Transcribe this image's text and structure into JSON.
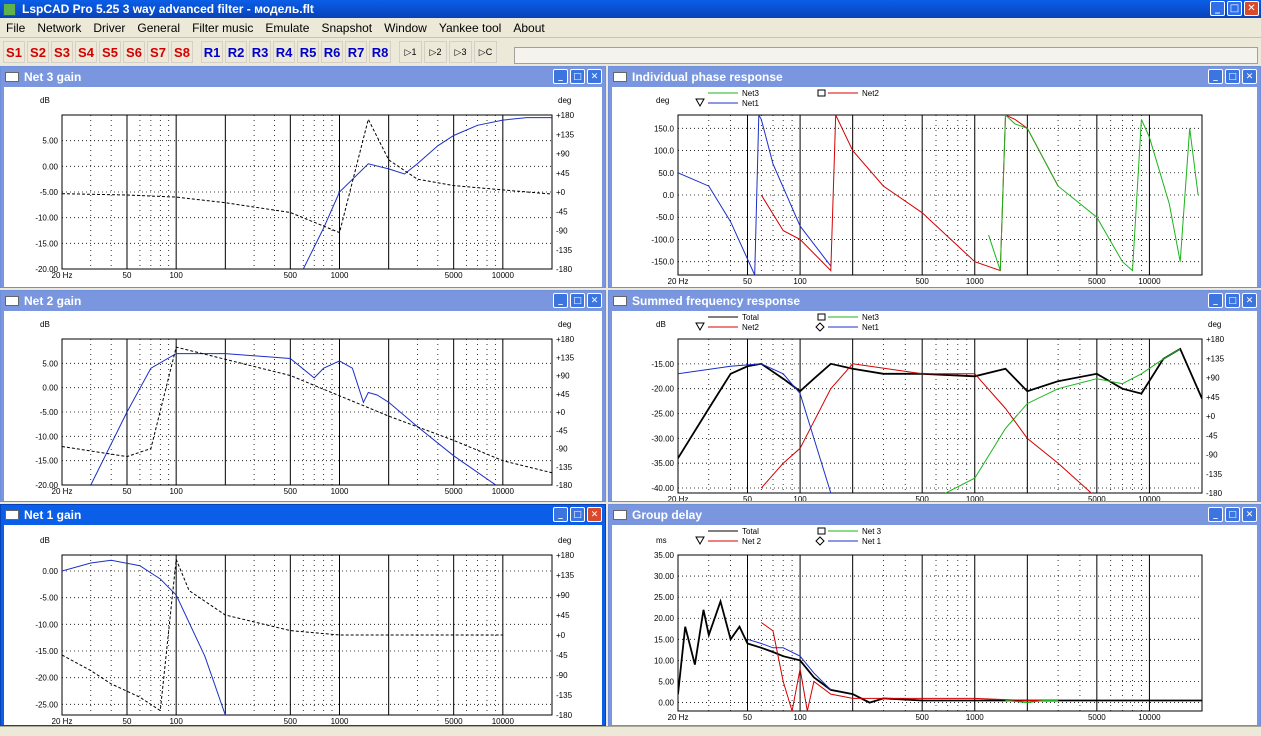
{
  "app": {
    "title": "LspCAD Pro 5.25 3 way advanced filter - модель.flt"
  },
  "menu": [
    "File",
    "Network",
    "Driver",
    "General",
    "Filter music",
    "Emulate",
    "Snapshot",
    "Window",
    "Yankee tool",
    "About"
  ],
  "toolbar": {
    "s_buttons": [
      "S1",
      "S2",
      "S3",
      "S4",
      "S5",
      "S6",
      "S7",
      "S8"
    ],
    "r_buttons": [
      "R1",
      "R2",
      "R3",
      "R4",
      "R5",
      "R6",
      "R7",
      "R8"
    ],
    "extra_buttons": [
      "▷1",
      "▷2",
      "▷3",
      "▷C"
    ]
  },
  "colors": {
    "total": "#000000",
    "net1": "#1c2fc8",
    "net2": "#d40000",
    "net3": "#1ab41a",
    "title_active": "#0a5ee8",
    "title_inactive": "#7a96df"
  },
  "log_x_ticks": [
    "20 Hz",
    "50",
    "100",
    "500",
    "1000",
    "5000",
    "10000"
  ],
  "windows": [
    {
      "id": "net3",
      "title": "Net 3 gain",
      "y_label": "dB",
      "y2_label": "deg",
      "y_ticks": [
        "5.00",
        "0.00",
        "-5.00",
        "-10.00",
        "-15.00",
        "-20.00"
      ],
      "y2_ticks": [
        "+180",
        "+135",
        "+90",
        "+45",
        "+0",
        "-45",
        "-90",
        "-135",
        "-180"
      ],
      "legend": []
    },
    {
      "id": "phase",
      "title": "Individual phase response",
      "y_label": "deg",
      "y_ticks": [
        "150.0",
        "100.0",
        "50.0",
        "0.0",
        "-50.0",
        "-100.0",
        "-150.0"
      ],
      "legend": [
        {
          "name": "Net3",
          "color": "#1ab41a",
          "marker": "none"
        },
        {
          "name": "Net2",
          "color": "#d40000",
          "marker": "square"
        },
        {
          "name": "Net1",
          "color": "#1c2fc8",
          "marker": "triangle"
        }
      ]
    },
    {
      "id": "net2",
      "title": "Net 2 gain",
      "y_label": "dB",
      "y2_label": "deg",
      "y_ticks": [
        "5.00",
        "0.00",
        "-5.00",
        "-10.00",
        "-15.00",
        "-20.00"
      ],
      "y2_ticks": [
        "+180",
        "+135",
        "+90",
        "+45",
        "+0",
        "-45",
        "-90",
        "-135",
        "-180"
      ],
      "legend": []
    },
    {
      "id": "summed",
      "title": "Summed frequency response",
      "y_label": "dB",
      "y2_label": "deg",
      "y_ticks": [
        "-15.00",
        "-20.00",
        "-25.00",
        "-30.00",
        "-35.00",
        "-40.00"
      ],
      "y2_ticks": [
        "+180",
        "+135",
        "+90",
        "+45",
        "+0",
        "-45",
        "-90",
        "-135",
        "-180"
      ],
      "legend": [
        {
          "name": "Total",
          "color": "#000000",
          "marker": "none"
        },
        {
          "name": "Net3",
          "color": "#1ab41a",
          "marker": "square"
        },
        {
          "name": "Net2",
          "color": "#d40000",
          "marker": "triangle"
        },
        {
          "name": "Net1",
          "color": "#1c2fc8",
          "marker": "diamond"
        }
      ]
    },
    {
      "id": "net1",
      "title": "Net 1 gain",
      "y_label": "dB",
      "y2_label": "deg",
      "y_ticks": [
        "0.00",
        "-5.00",
        "-10.00",
        "-15.00",
        "-20.00",
        "-25.00"
      ],
      "y2_ticks": [
        "+180",
        "+135",
        "+90",
        "+45",
        "+0",
        "-45",
        "-90",
        "-135",
        "-180"
      ],
      "legend": []
    },
    {
      "id": "gd",
      "title": "Group delay",
      "y_label": "ms",
      "y_ticks": [
        "35.00",
        "30.00",
        "25.00",
        "20.00",
        "15.00",
        "10.00",
        "5.00",
        "0.00"
      ],
      "legend": [
        {
          "name": "Total",
          "color": "#000000",
          "marker": "none"
        },
        {
          "name": "Net 3",
          "color": "#1ab41a",
          "marker": "square"
        },
        {
          "name": "Net 2",
          "color": "#d40000",
          "marker": "triangle"
        },
        {
          "name": "Net 1",
          "color": "#1c2fc8",
          "marker": "diamond"
        }
      ]
    }
  ],
  "chart_data": [
    {
      "type": "line",
      "title": "Net 3 gain",
      "xlabel": "",
      "ylabel": "dB",
      "x_scale": "log",
      "xlim": [
        20,
        20000
      ],
      "ylim": [
        -20,
        10
      ],
      "y2lim": [
        -180,
        180
      ],
      "series": [
        {
          "name": "",
          "role": "magnitude",
          "color": "#1c2fc8",
          "x": [
            600,
            800,
            1000,
            1500,
            2000,
            2500,
            3000,
            4000,
            5000,
            7000,
            10000,
            14000,
            20000
          ],
          "y": [
            -20,
            -12,
            -5,
            0.5,
            -0.5,
            -1.5,
            0.5,
            4,
            6,
            8,
            9,
            9.5,
            9.5
          ]
        },
        {
          "name": "",
          "role": "phase",
          "color": "#000000",
          "x": [
            20,
            50,
            100,
            200,
            500,
            1000,
            1500,
            2000,
            3000,
            5000,
            10000,
            20000
          ],
          "y": [
            -4,
            -7,
            -12,
            -25,
            -48,
            -95,
            170,
            75,
            30,
            15,
            5,
            -5
          ]
        }
      ]
    },
    {
      "type": "line",
      "title": "Individual phase response",
      "xlabel": "",
      "ylabel": "deg",
      "x_scale": "log",
      "xlim": [
        20,
        20000
      ],
      "ylim": [
        -180,
        180
      ],
      "series": [
        {
          "name": "Net1",
          "color": "#1c2fc8",
          "x": [
            20,
            30,
            40,
            55,
            58,
            60,
            70,
            100,
            150
          ],
          "y": [
            50,
            20,
            -60,
            -180,
            180,
            170,
            70,
            -70,
            -160
          ]
        },
        {
          "name": "Net2",
          "color": "#d40000",
          "x": [
            60,
            80,
            100,
            150,
            160,
            200,
            300,
            500,
            1000,
            1400,
            1500,
            1700,
            2000,
            3000
          ],
          "y": [
            0,
            -80,
            -100,
            -170,
            180,
            100,
            20,
            -40,
            -150,
            -170,
            180,
            170,
            150,
            20
          ]
        },
        {
          "name": "Net3",
          "color": "#1ab41a",
          "x": [
            1200,
            1400,
            1500,
            1700,
            2000,
            3000,
            5000,
            7000,
            8000,
            9000,
            10000,
            13000,
            15000,
            17000,
            19000
          ],
          "y": [
            -90,
            -170,
            180,
            160,
            150,
            20,
            -50,
            -150,
            -170,
            170,
            130,
            -20,
            -150,
            150,
            0
          ]
        }
      ]
    },
    {
      "type": "line",
      "title": "Net 2 gain",
      "xlabel": "",
      "ylabel": "dB",
      "x_scale": "log",
      "xlim": [
        20,
        20000
      ],
      "ylim": [
        -20,
        10
      ],
      "y2lim": [
        -180,
        180
      ],
      "series": [
        {
          "name": "",
          "role": "magnitude",
          "color": "#1c2fc8",
          "x": [
            30,
            50,
            70,
            100,
            200,
            500,
            700,
            800,
            1000,
            1200,
            1400,
            1500,
            1700,
            2000,
            3000,
            5000,
            10000
          ],
          "y": [
            -20,
            -5,
            4,
            7,
            7,
            6,
            2,
            4,
            5.5,
            4,
            -3,
            -1,
            -1.5,
            -3,
            -8,
            -14,
            -21
          ]
        },
        {
          "name": "",
          "role": "phase",
          "color": "#000000",
          "x": [
            20,
            50,
            70,
            100,
            200,
            500,
            1000,
            2000,
            5000,
            10000,
            20000
          ],
          "y": [
            -85,
            -110,
            -90,
            160,
            130,
            90,
            40,
            -10,
            -70,
            -120,
            -150
          ]
        }
      ]
    },
    {
      "type": "line",
      "title": "Summed frequency response",
      "xlabel": "",
      "ylabel": "dB",
      "x_scale": "log",
      "xlim": [
        20,
        20000
      ],
      "ylim": [
        -41,
        -10
      ],
      "y2lim": [
        -180,
        180
      ],
      "series": [
        {
          "name": "Total",
          "color": "#000000",
          "x": [
            20,
            30,
            40,
            50,
            60,
            80,
            100,
            120,
            150,
            200,
            300,
            500,
            1000,
            1500,
            2000,
            3000,
            5000,
            7000,
            9000,
            12000,
            15000,
            20000
          ],
          "y": [
            -34,
            -24,
            -17,
            -15.5,
            -15,
            -18,
            -20.5,
            -18,
            -15,
            -16,
            -17,
            -17,
            -17.5,
            -16,
            -20.5,
            -18.5,
            -17,
            -20,
            -21,
            -14,
            -12,
            -22
          ]
        },
        {
          "name": "Net3",
          "color": "#1ab41a",
          "x": [
            600,
            1000,
            1500,
            2000,
            3000,
            5000,
            7000,
            9000,
            12000,
            15000
          ],
          "y": [
            -42,
            -38,
            -28,
            -23,
            -20,
            -18,
            -19,
            -17,
            -14,
            -12
          ]
        },
        {
          "name": "Net2",
          "color": "#d40000",
          "x": [
            60,
            80,
            100,
            150,
            200,
            500,
            1000,
            1500,
            2000,
            3000,
            5000
          ],
          "y": [
            -40,
            -35,
            -32,
            -20,
            -15,
            -17,
            -17,
            -24,
            -30,
            -35,
            -42
          ]
        },
        {
          "name": "Net1",
          "color": "#1c2fc8",
          "x": [
            20,
            40,
            60,
            80,
            100,
            120,
            150
          ],
          "y": [
            -17,
            -15.5,
            -15,
            -17,
            -21,
            -30,
            -41
          ]
        }
      ]
    },
    {
      "type": "line",
      "title": "Net 1 gain",
      "xlabel": "",
      "ylabel": "dB",
      "x_scale": "log",
      "xlim": [
        20,
        20000
      ],
      "ylim": [
        -27,
        3
      ],
      "y2lim": [
        -180,
        180
      ],
      "series": [
        {
          "name": "",
          "role": "magnitude",
          "color": "#1c2fc8",
          "x": [
            20,
            30,
            40,
            60,
            80,
            100,
            150,
            200
          ],
          "y": [
            0,
            1.5,
            2,
            1,
            -1.5,
            -4.5,
            -16,
            -27
          ]
        },
        {
          "name": "",
          "role": "phase",
          "color": "#000000",
          "x": [
            20,
            30,
            40,
            60,
            80,
            100,
            120,
            200,
            500,
            1000,
            3000,
            10000
          ],
          "y": [
            -45,
            -80,
            -110,
            -140,
            -170,
            170,
            100,
            45,
            10,
            0,
            0,
            0
          ]
        }
      ]
    },
    {
      "type": "line",
      "title": "Group delay",
      "xlabel": "",
      "ylabel": "ms",
      "x_scale": "log",
      "xlim": [
        20,
        20000
      ],
      "ylim": [
        -2,
        35
      ],
      "series": [
        {
          "name": "Total",
          "color": "#000000",
          "x": [
            20,
            22,
            25,
            28,
            30,
            35,
            40,
            45,
            50,
            60,
            70,
            80,
            100,
            120,
            150,
            200,
            250,
            300,
            500,
            1000,
            2000,
            5000,
            10000,
            20000
          ],
          "y": [
            2,
            18,
            9,
            22,
            16,
            24,
            15,
            18,
            14,
            13,
            12,
            11,
            10,
            6,
            3,
            2,
            0,
            1,
            0.5,
            0.5,
            0.5,
            0.5,
            0.5,
            0.5
          ]
        },
        {
          "name": "Net 2",
          "color": "#d40000",
          "x": [
            60,
            70,
            80,
            90,
            100,
            110,
            120,
            150,
            200,
            300,
            500,
            1000,
            2000,
            3000
          ],
          "y": [
            19,
            17,
            5,
            -2,
            8,
            -2,
            5,
            2,
            1,
            1,
            1,
            1,
            0.5,
            0.5
          ]
        },
        {
          "name": "Net 1",
          "color": "#1c2fc8",
          "x": [
            50,
            60,
            70,
            80,
            100,
            120,
            150
          ],
          "y": [
            15,
            14,
            13,
            13,
            11,
            7,
            3
          ]
        },
        {
          "name": "Net 3",
          "color": "#1ab41a",
          "x": [
            1500,
            2000,
            2500,
            3000
          ],
          "y": [
            0.5,
            0,
            0.5,
            0.5
          ]
        }
      ]
    }
  ]
}
